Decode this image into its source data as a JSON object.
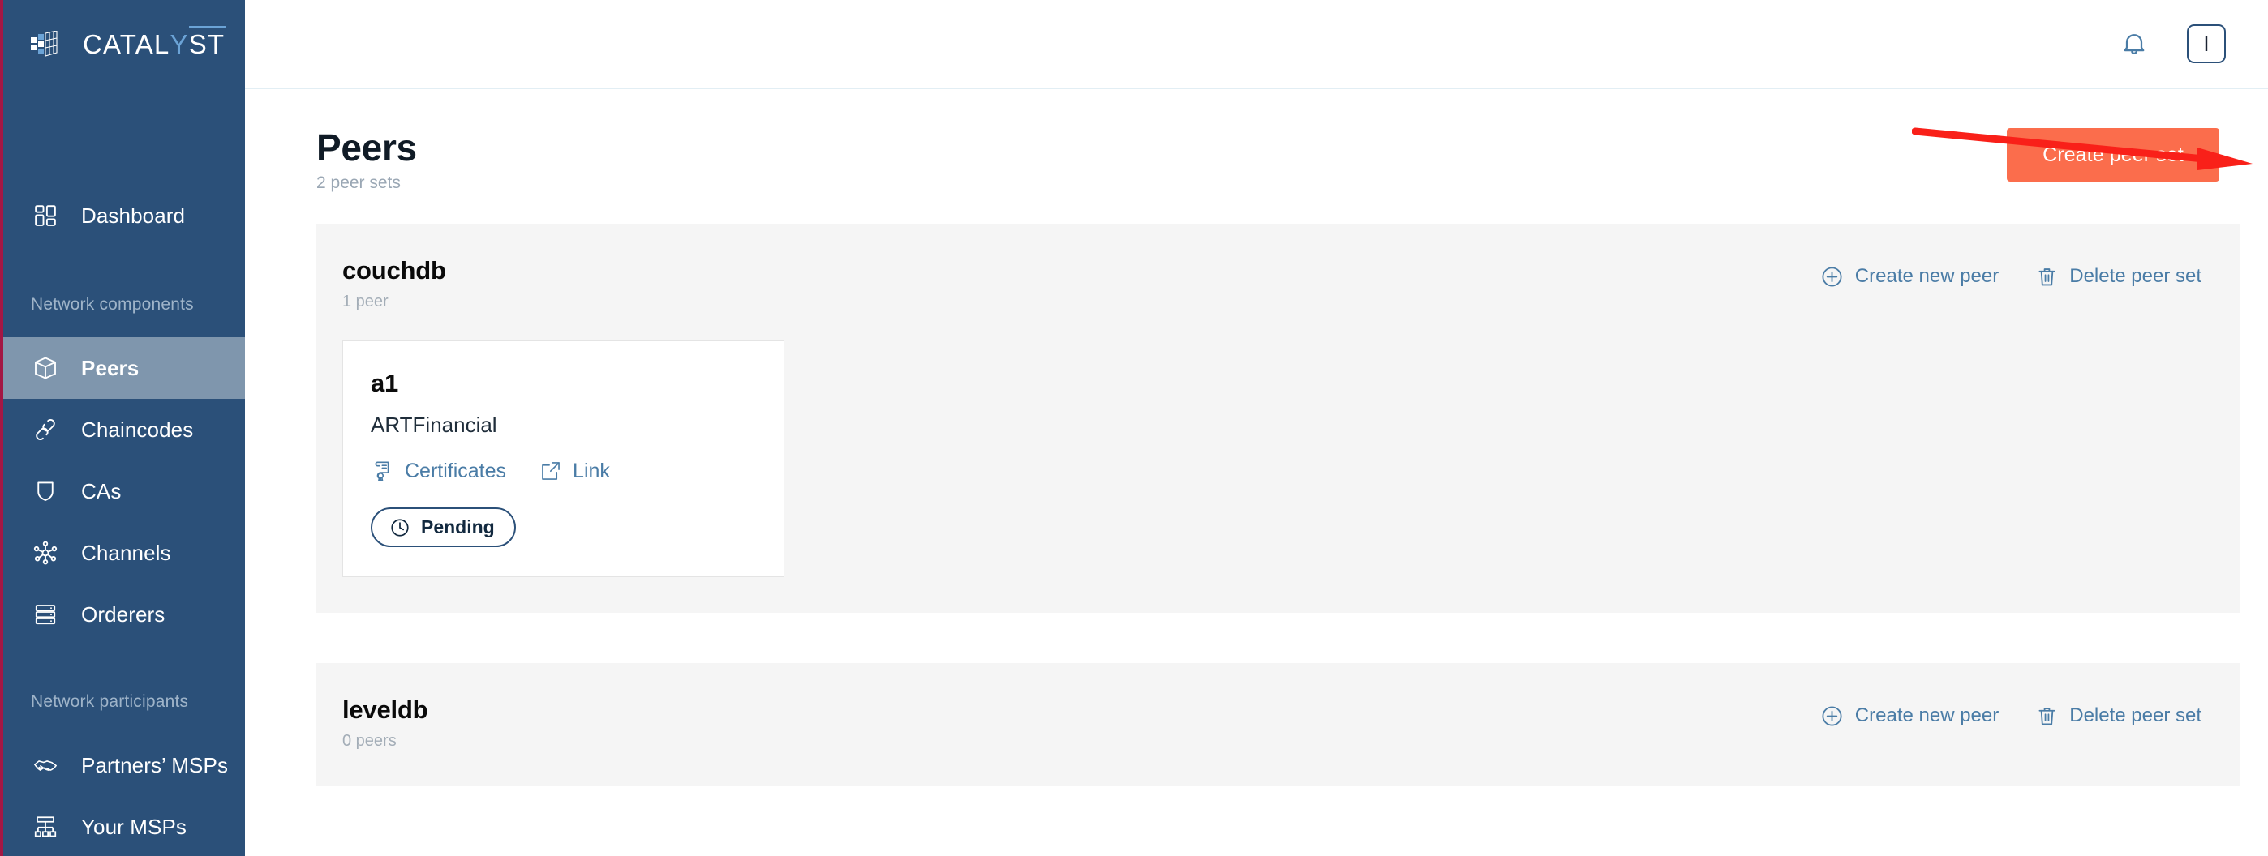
{
  "brand": {
    "name_part1": "CATAL",
    "name_highlight": "Y",
    "name_part2": "ST",
    "logo_icon": "cube-grid-icon",
    "collapse_icon": "chevron-left-icon"
  },
  "sidebar": {
    "top_items": [
      {
        "label": "Dashboard",
        "icon": "dashboard-grid-icon",
        "active": false
      }
    ],
    "sections": [
      {
        "label": "Network components",
        "items": [
          {
            "label": "Peers",
            "icon": "cube-icon",
            "active": true
          },
          {
            "label": "Chaincodes",
            "icon": "link-chain-icon",
            "active": false
          },
          {
            "label": "CAs",
            "icon": "shield-icon",
            "active": false
          },
          {
            "label": "Channels",
            "icon": "network-nodes-icon",
            "active": false
          },
          {
            "label": "Orderers",
            "icon": "server-rack-icon",
            "active": false
          }
        ]
      },
      {
        "label": "Network participants",
        "items": [
          {
            "label": "Partners’ MSPs",
            "icon": "handshake-icon",
            "active": false
          },
          {
            "label": "Your MSPs",
            "icon": "org-tree-icon",
            "active": false
          }
        ]
      }
    ]
  },
  "topbar": {
    "notifications_icon": "bell-icon",
    "avatar_initial": "I"
  },
  "header": {
    "title": "Peers",
    "subtitle": "2 peer sets",
    "create_button": "Create peer set"
  },
  "annotation": {
    "type": "arrow",
    "color": "#f92019",
    "points_to": "Create peer set"
  },
  "peer_sets": [
    {
      "name": "couchdb",
      "count_label": "1 peer",
      "actions": [
        {
          "label": "Create new peer",
          "icon": "plus-circle-icon"
        },
        {
          "label": "Delete peer set",
          "icon": "trash-icon"
        }
      ],
      "peers": [
        {
          "name": "a1",
          "org": "ARTFinancial",
          "links": [
            {
              "label": "Certificates",
              "icon": "certificate-icon"
            },
            {
              "label": "Link",
              "icon": "external-link-icon"
            }
          ],
          "status": {
            "label": "Pending",
            "icon": "clock-icon"
          }
        }
      ]
    },
    {
      "name": "leveldb",
      "count_label": "0 peers",
      "actions": [
        {
          "label": "Create new peer",
          "icon": "plus-circle-icon"
        },
        {
          "label": "Delete peer set",
          "icon": "trash-icon"
        }
      ],
      "peers": []
    }
  ],
  "colors": {
    "sidebar_bg": "#2b5079",
    "sidebar_active": "#7f96ad",
    "sidebar_edge": "#a31744",
    "accent_orange": "#fb6d4c",
    "link_blue": "#4a7ca6",
    "panel_bg": "#f5f5f5",
    "annotation_red": "#f92019"
  }
}
